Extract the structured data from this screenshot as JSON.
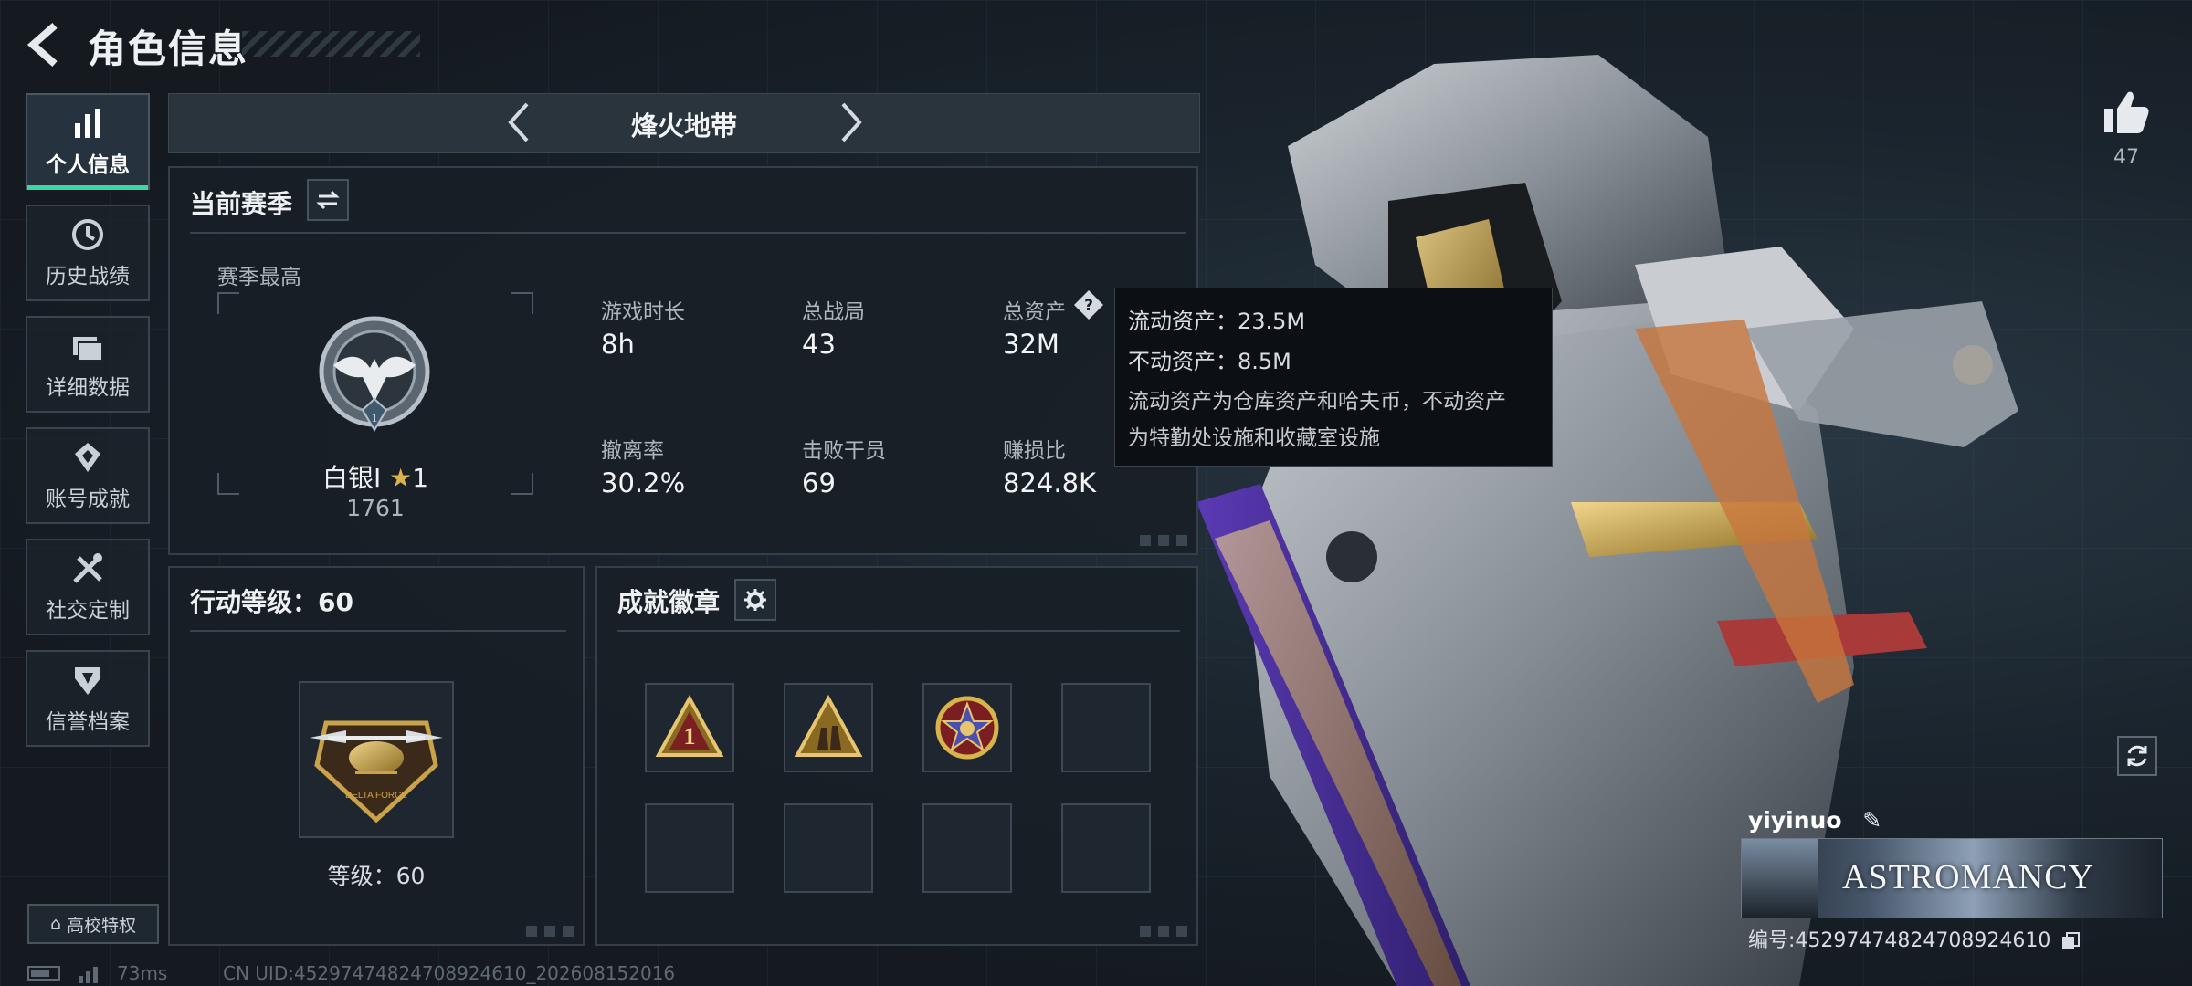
{
  "header": {
    "title": "角色信息"
  },
  "sidebar": {
    "items": [
      {
        "label": "个人信息",
        "icon": "bar-chart-icon",
        "active": true
      },
      {
        "label": "历史战绩",
        "icon": "clock-icon"
      },
      {
        "label": "详细数据",
        "icon": "folder-icon"
      },
      {
        "label": "账号成就",
        "icon": "achievement-icon"
      },
      {
        "label": "社交定制",
        "icon": "tools-icon"
      },
      {
        "label": "信誉档案",
        "icon": "credibility-icon"
      }
    ],
    "campus_label": "高校特权"
  },
  "status_bar": {
    "ping": "73ms",
    "uid": "CN UID:452974748247089246​10_202608152016"
  },
  "mode": {
    "label": "烽火地带"
  },
  "season": {
    "title": "当前赛季",
    "best_label": "赛季最高",
    "rank_name": "白银I",
    "rank_stars": "1",
    "rank_points": "1761",
    "rank_emblem_digit": "1",
    "stats": [
      {
        "label": "游戏时长",
        "value": "8h"
      },
      {
        "label": "总战局",
        "value": "43"
      },
      {
        "label": "总资产",
        "value": "32M"
      },
      {
        "label": "撤离率",
        "value": "30.2%"
      },
      {
        "label": "击败干员",
        "value": "69"
      },
      {
        "label": "赚损比",
        "value": "824.8K"
      }
    ]
  },
  "tooltip": {
    "liquid": "流动资产：23.5M",
    "fixed": "不动资产：8.5M",
    "note_line1": "流动资产为仓库资产和哈夫币，不动资产",
    "note_line2": "为特勤处设施和收藏室设施"
  },
  "action_level": {
    "title": "行动等级：60",
    "level_label": "等级：60",
    "emblem_text": "DELTA FORCE"
  },
  "achievements": {
    "title": "成就徽章",
    "badges": [
      "1",
      "",
      "",
      "",
      "",
      "",
      "",
      ""
    ]
  },
  "likes": {
    "count": "47"
  },
  "profile_card": {
    "name": "yiyinuo",
    "banner_text": "ASTROMANCY",
    "id": "编号:452974748247089246​10"
  },
  "colors": {
    "accent": "#3bd8a3",
    "bg": "#151c23",
    "gold": "#c9a24a"
  }
}
